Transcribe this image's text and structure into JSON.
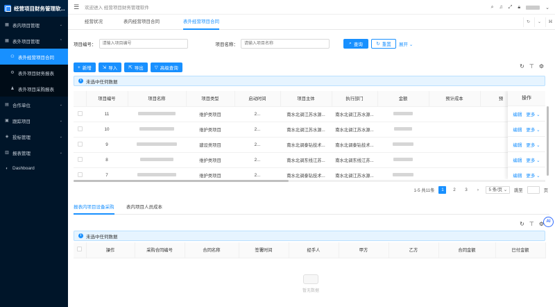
{
  "app": {
    "title": "经营项目财务管理软...",
    "welcome": "欢迎进入 经营项目财务管理软件"
  },
  "sidebar": {
    "items": [
      {
        "label": "表内项目管理",
        "icon": "grid-icon",
        "arrow": "⌄"
      },
      {
        "label": "表外项目管理",
        "icon": "grid-icon",
        "arrow": "⌃"
      },
      {
        "label": "表外经营项目合同",
        "icon": "user-group-icon",
        "active": true
      },
      {
        "label": "表外项目财务报表",
        "icon": "gear-icon"
      },
      {
        "label": "表外项目采购报表",
        "icon": "user-icon"
      },
      {
        "label": "合作单位",
        "icon": "building-icon",
        "arrow": "⌄"
      },
      {
        "label": "跟踪项目",
        "icon": "folder-icon",
        "arrow": "⌄"
      },
      {
        "label": "投标管理",
        "icon": "briefcase-icon",
        "arrow": "⌄"
      },
      {
        "label": "报表管理",
        "icon": "document-icon",
        "arrow": "⌄"
      },
      {
        "label": "Dashboard",
        "icon": "dashboard-icon"
      }
    ]
  },
  "tabs": [
    {
      "label": "经营状况"
    },
    {
      "label": "表内经营项目合同"
    },
    {
      "label": "表外经营项目合同",
      "active": true
    }
  ],
  "search": {
    "code_label": "项目编号：",
    "code_placeholder": "请输入项目编号",
    "name_label": "项目名称：",
    "name_placeholder": "请输入项目名称",
    "query": "查询",
    "reset": "重置",
    "expand": "展开"
  },
  "toolbar": {
    "add": "新增",
    "import": "导入",
    "export": "导出",
    "advanced": "高级查询"
  },
  "alert1": "未选中任何数据",
  "table1": {
    "columns": [
      "项目编号",
      "项目名称",
      "项目类型",
      "启动时间",
      "项目主体",
      "执行部门",
      "金额",
      "预计成本",
      "操作"
    ],
    "rows": [
      {
        "code": "11",
        "type": "维护类项目",
        "start": "2...",
        "entity": "南水北调江苏水源...",
        "dept": "南水北调江苏水源..."
      },
      {
        "code": "10",
        "type": "维护类项目",
        "start": "2...",
        "entity": "南水北调江苏水源...",
        "dept": "南水北调江苏水源..."
      },
      {
        "code": "9",
        "type": "建设类项目",
        "start": "2...",
        "entity": "南水北调泰钻技术...",
        "dept": "南水北调泰钻技术..."
      },
      {
        "code": "8",
        "type": "维护类项目",
        "start": "2...",
        "entity": "南水北调东线江苏...",
        "dept": "南水北调东线江苏..."
      },
      {
        "code": "7",
        "type": "维护类项目",
        "start": "2...",
        "entity": "南水北调泰钻技术...",
        "dept": "南水北调江苏水源..."
      }
    ],
    "edit": "编辑",
    "more": "更多"
  },
  "pager": {
    "summary": "1-5 共11条",
    "pages": [
      "1",
      "2",
      "3"
    ],
    "current": "1",
    "size": "5 条/页",
    "jump": "跳至",
    "page_unit": "页"
  },
  "tabs2": [
    {
      "label": "报表内项目设备采购",
      "active": true
    },
    {
      "label": "表内项目人员成本"
    }
  ],
  "alert2": "未选中任何数据",
  "table2": {
    "columns": [
      "操作",
      "采购合同编号",
      "合同名称",
      "签署时间",
      "经手人",
      "甲方",
      "乙方",
      "合同金额",
      "已付金额"
    ]
  },
  "empty_text": "暂无数据",
  "ai_label": "AI",
  "colors": {
    "primary": "#1890ff",
    "sidebar": "#001529"
  }
}
